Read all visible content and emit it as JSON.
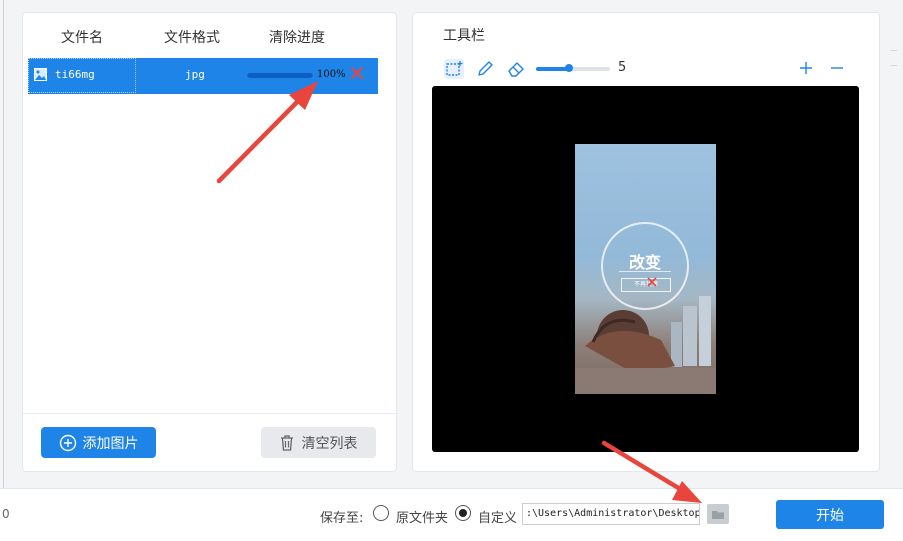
{
  "file_list": {
    "headers": [
      "文件名",
      "文件格式",
      "清除进度"
    ],
    "rows": [
      {
        "name": "ti66mg",
        "format": "jpg",
        "progress_text": "100%",
        "progress": 1.0,
        "remove_icon": "close-icon"
      }
    ]
  },
  "left_actions": {
    "add_label": "添加图片",
    "clear_label": "清空列表"
  },
  "toolbar": {
    "title": "工具栏",
    "tools": [
      "rect-select-icon",
      "pencil-icon",
      "eraser-icon"
    ],
    "brush_size": "5",
    "brush_level": 0.45,
    "zoom_in": "plus-icon",
    "zoom_out": "minus-icon"
  },
  "preview": {
    "headline": "改变",
    "subline": "不再犹豫"
  },
  "bottom": {
    "left_number": "0",
    "save_to_label": "保存至:",
    "options": [
      "原文件夹",
      "自定义"
    ],
    "selected_option": "自定义",
    "path_value": ":\\Users\\Administrator\\Desktop",
    "start_label": "开始"
  },
  "colors": {
    "accent": "#1e84e8",
    "arrow": "#e8453c",
    "canvas": "#000000"
  }
}
